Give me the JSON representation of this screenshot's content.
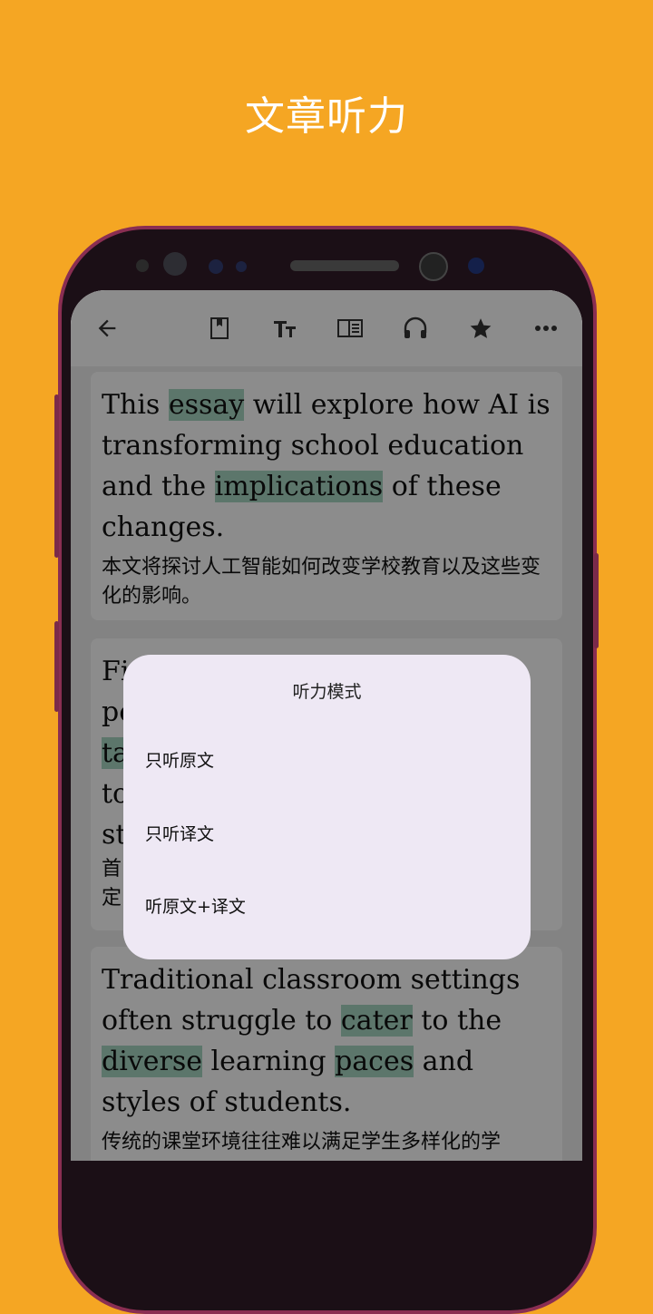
{
  "promo": {
    "title": "文章听力"
  },
  "toolbar": {
    "back_icon": "arrow-left-icon",
    "icons": [
      "bookmark-icon",
      "text-size-icon",
      "reader-view-icon",
      "headphones-icon",
      "star-icon",
      "more-dots-icon"
    ]
  },
  "article": {
    "paragraphs": [
      {
        "en_parts": [
          {
            "t": "This ",
            "h": false
          },
          {
            "t": "essay",
            "h": true
          },
          {
            "t": " will explore how AI is transforming school education and the ",
            "h": false
          },
          {
            "t": "implications",
            "h": true
          },
          {
            "t": " of these changes.",
            "h": false
          }
        ],
        "zh": "本文将探讨人工智能如何改变学校教育以及这些变化的影响。"
      },
      {
        "en_parts": [
          {
            "t": "Fi",
            "h": false
          }
        ],
        "en_lines_visible": [
          "Fi",
          "pe",
          "ta",
          "to",
          "st"
        ],
        "zh_visible": [
          "首",
          "定"
        ]
      },
      {
        "en_parts": [
          {
            "t": "Traditional classroom settings often struggle to ",
            "h": false
          },
          {
            "t": "cater",
            "h": true
          },
          {
            "t": " to the ",
            "h": false
          },
          {
            "t": "diverse",
            "h": true
          },
          {
            "t": " learning ",
            "h": false
          },
          {
            "t": "paces",
            "h": true
          },
          {
            "t": " and styles of students.",
            "h": false
          }
        ],
        "zh": "传统的课堂环境往往难以满足学生多样化的学"
      }
    ]
  },
  "dialog": {
    "title": "听力模式",
    "options": [
      "只听原文",
      "只听译文",
      "听原文+译文"
    ]
  },
  "colors": {
    "background": "#F5A623",
    "highlight": "#a8d8c4",
    "dialog": "#EEE8F4"
  }
}
